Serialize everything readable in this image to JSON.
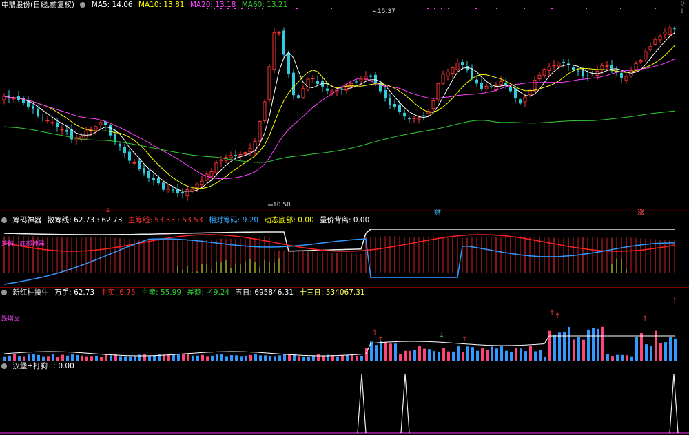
{
  "main": {
    "stock": "中鼎股份(日线,前复权)",
    "ma5": "MA5: 14.06",
    "ma10": "MA10: 13.81",
    "ma20": "MA20: 13.18",
    "ma60": "MA60: 13.21",
    "high_label": "15.37",
    "low_label": "10.50",
    "markers": [
      "s",
      "财",
      "涨"
    ]
  },
  "chip": {
    "title": "筹码神器",
    "p1": "散筹线: 62.73 : 62.73",
    "p2": "主筹线: 53.53 : 53.53",
    "p3": "相对筹码: 9.20",
    "p4": "动态底部: 0.00",
    "p5": "量价背离: 0.00",
    "overlay": "筹码 · 底部神器"
  },
  "vol": {
    "title": "新红柱擒牛",
    "wanshou": "万手: 62.73",
    "zhuli": "主买: 6.75",
    "zhumai": "主卖: 55.99",
    "diff": "差额: -49.24",
    "wuri": "五日: 695846.31",
    "shisanri": "十三日: 534067.31",
    "tag": "跌增文"
  },
  "bottom": {
    "title": "汉堡+打狗",
    "value": ": 0.00"
  },
  "colors": {
    "up": "#ff3333",
    "down": "#33ccdd",
    "ma5": "#ffffff",
    "ma10": "#ffff00",
    "ma20": "#ff00ff",
    "ma60": "#33cc33"
  }
}
